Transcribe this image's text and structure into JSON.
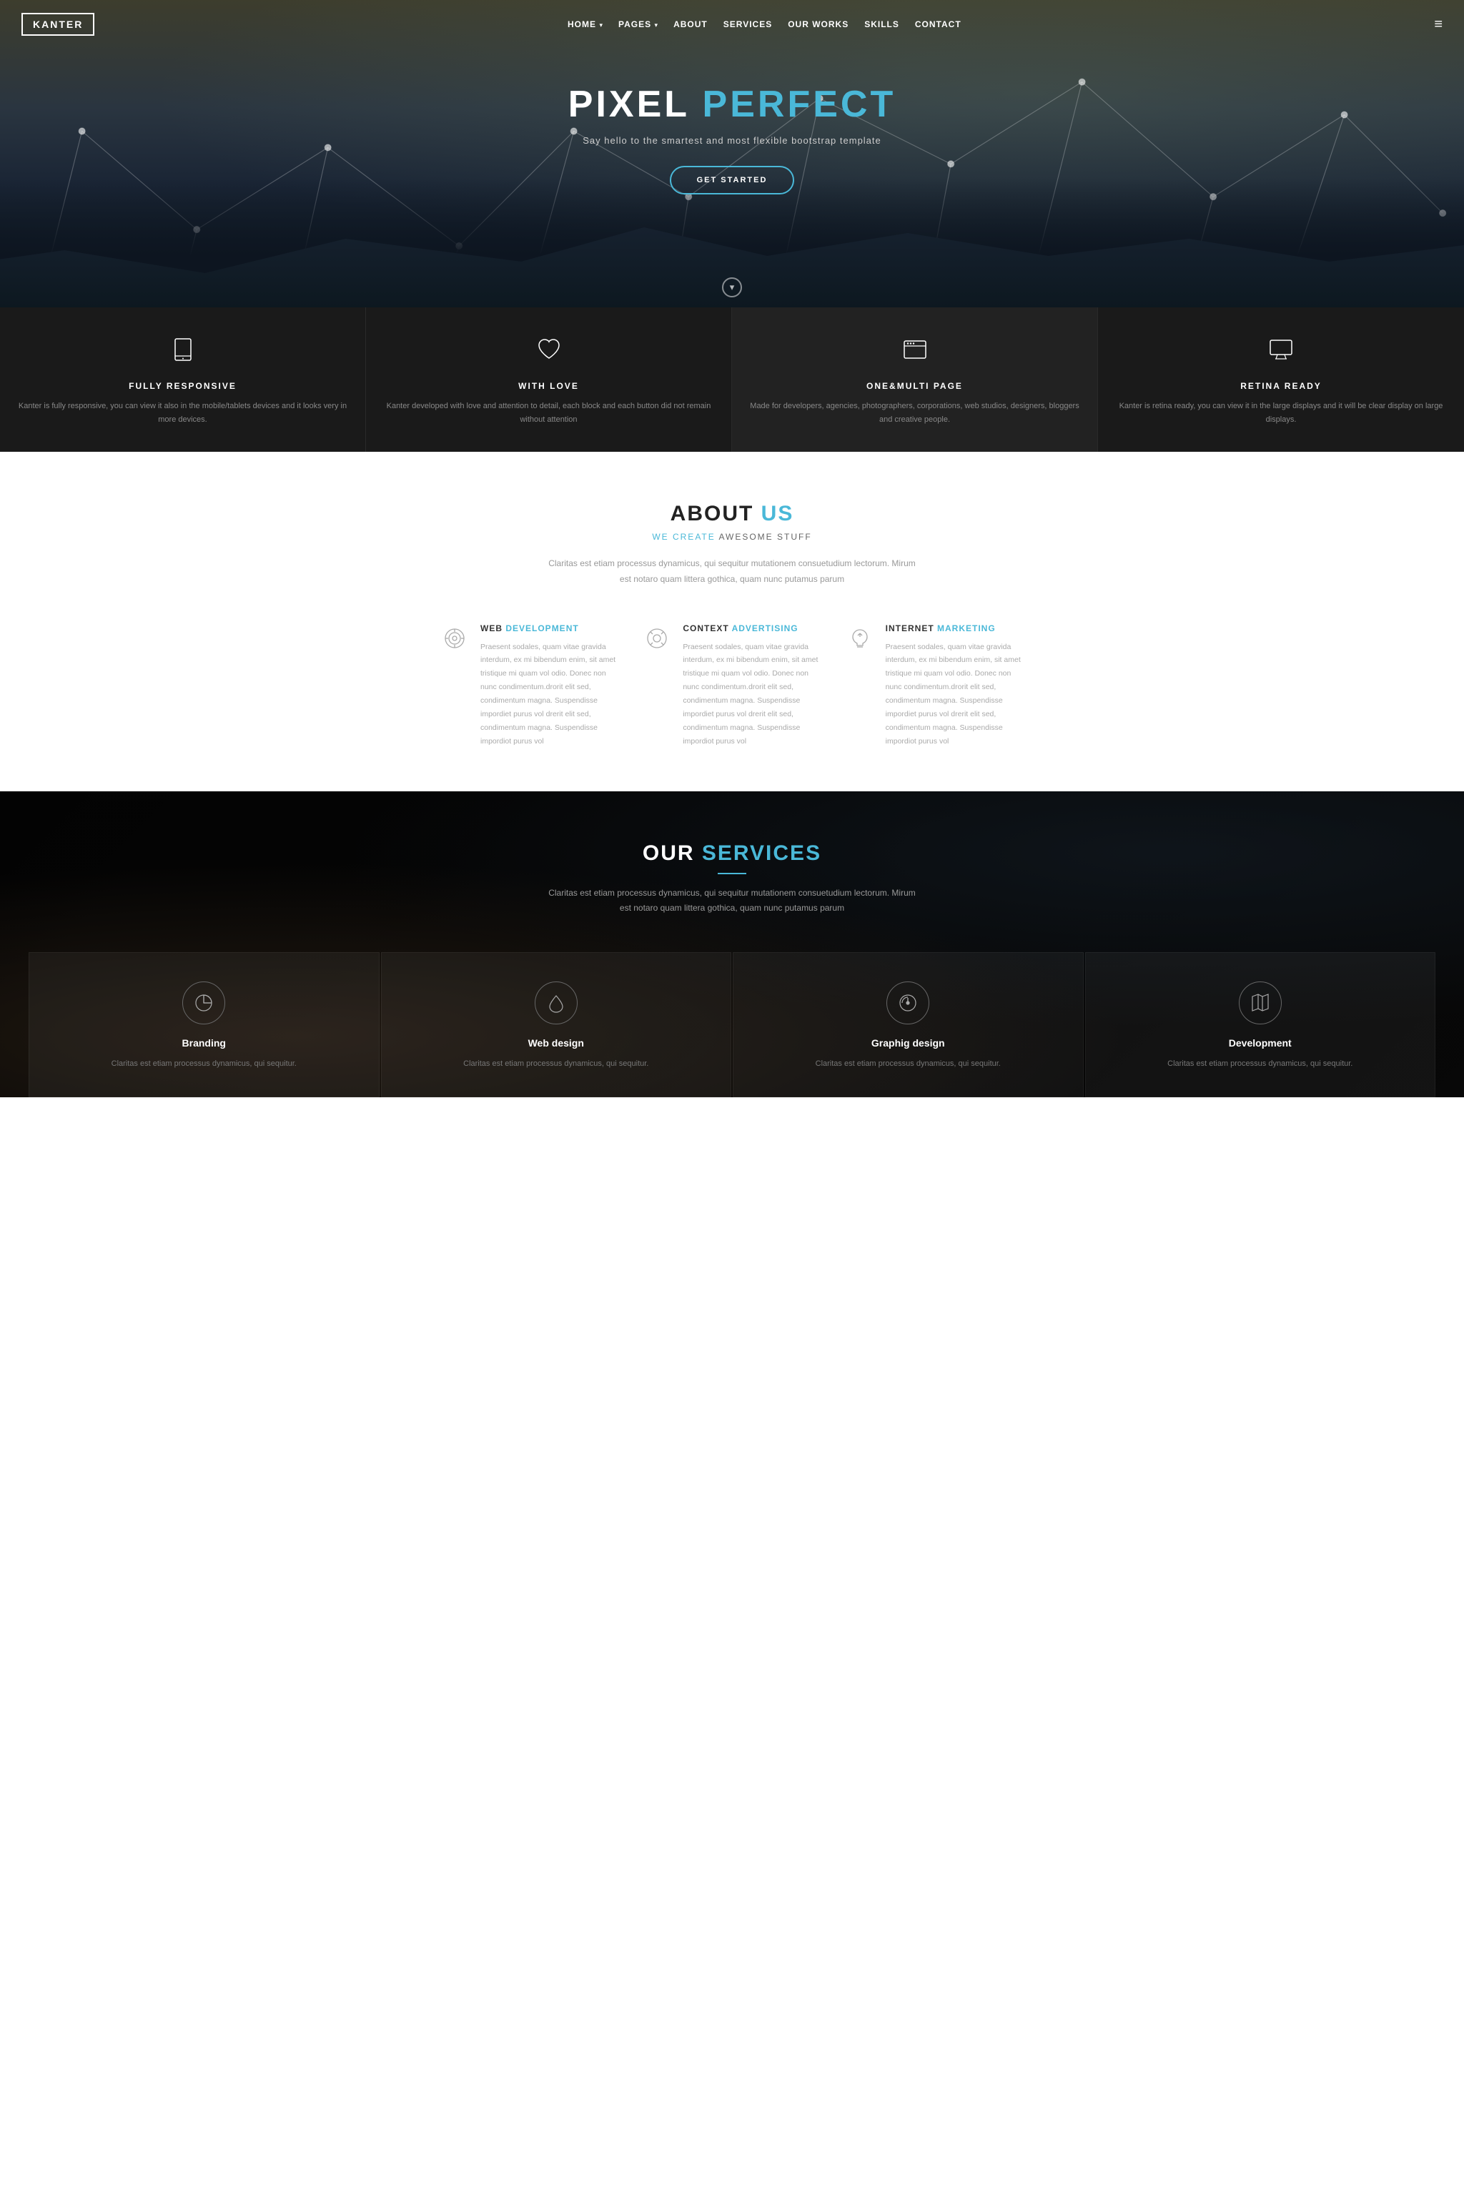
{
  "navbar": {
    "logo": "KANTER",
    "links": [
      {
        "label": "HOME",
        "has_dropdown": true
      },
      {
        "label": "PAGES",
        "has_dropdown": true
      },
      {
        "label": "ABOUT",
        "has_dropdown": false
      },
      {
        "label": "SERVICES",
        "has_dropdown": false
      },
      {
        "label": "OUR WORKS",
        "has_dropdown": false
      },
      {
        "label": "SKILLS",
        "has_dropdown": false
      },
      {
        "label": "CONTACT",
        "has_dropdown": false
      }
    ]
  },
  "hero": {
    "title_plain": "PIXEL ",
    "title_accent": "PERFECT",
    "subtitle": "Say hello to the smartest and most flexible bootstrap template",
    "btn_label": "GET STARTED",
    "scroll_icon": "▾"
  },
  "features": [
    {
      "icon": "tablet",
      "title": "FULLY RESPONSIVE",
      "text": "Kanter is fully responsive, you can view it also in the mobile/tablets devices and it looks very in more devices."
    },
    {
      "icon": "heart",
      "title": "WITH LOVE",
      "text": "Kanter developed with love and attention to detail, each block and each button did not remain without attention"
    },
    {
      "icon": "browser",
      "title": "ONE&MULTI PAGE",
      "text": "Made for developers, agencies, photographers, corporations, web studios, designers, bloggers and creative people."
    },
    {
      "icon": "monitor",
      "title": "RETINA READY",
      "text": "Kanter is retina ready, you can view it in the large displays and it will be clear display on large displays."
    }
  ],
  "about": {
    "heading_plain": "ABOUT ",
    "heading_accent": "US",
    "subheading_accent": "WE CREATE",
    "subheading_plain": " AWESOME STUFF",
    "desc": "Claritas est etiam processus dynamicus, qui sequitur mutationem consuetudium lectorum. Mirum est notaro quam littera gothica, quam nunc putamus parum",
    "services": [
      {
        "icon": "target",
        "title_plain": "WEB ",
        "title_accent": "DEVELOPMENT",
        "text": "Praesent sodales, quam vitae gravida interdum, ex mi bibendum enim, sit amet tristique mi quam vol odio. Donec non nunc condimentum.drorit elit sed, condimentum magna. Suspendisse impordiet purus vol drerit elit sed, condimentum magna. Suspendisse impordiot purus vol"
      },
      {
        "icon": "lifesaver",
        "title_plain": "CONTEXT ",
        "title_accent": "ADVERTISING",
        "text": "Praesent sodales, quam vitae gravida interdum, ex mi bibendum enim, sit amet tristique mi quam vol odio. Donec non nunc condimentum.drorit elit sed, condimentum magna. Suspendisse impordiet purus vol drerit elit sed, condimentum magna. Suspendisse impordiot purus vol"
      },
      {
        "icon": "bulb",
        "title_plain": "INTERNET ",
        "title_accent": "MARKETING",
        "text": "Praesent sodales, quam vitae gravida interdum, ex mi bibendum enim, sit amet tristique mi quam vol odio. Donec non nunc condimentum.drorit elit sed, condimentum magna. Suspendisse impordiet purus vol drerit elit sed, condimentum magna. Suspendisse impordiot purus vol"
      }
    ]
  },
  "services_section": {
    "heading_plain": "OUR ",
    "heading_accent": "SERVICES",
    "desc": "Claritas est etiam processus dynamicus, qui sequitur mutationem consuetudium lectorum. Mirum est notaro quam littera gothica, quam nunc putamus parum",
    "cards": [
      {
        "icon": "pie",
        "title": "Branding",
        "text": "Claritas est etiam processus dynamicus, qui sequitur."
      },
      {
        "icon": "drop",
        "title": "Web design",
        "text": "Claritas est etiam processus dynamicus, qui sequitur."
      },
      {
        "icon": "dial",
        "title": "Graphig design",
        "text": "Claritas est etiam processus dynamicus, qui sequitur."
      },
      {
        "icon": "map",
        "title": "Development",
        "text": "Claritas est etiam processus dynamicus, qui sequitur."
      }
    ]
  },
  "colors": {
    "accent": "#4ab8d8",
    "dark_bg": "#1a1a1a",
    "text_muted": "#999"
  }
}
